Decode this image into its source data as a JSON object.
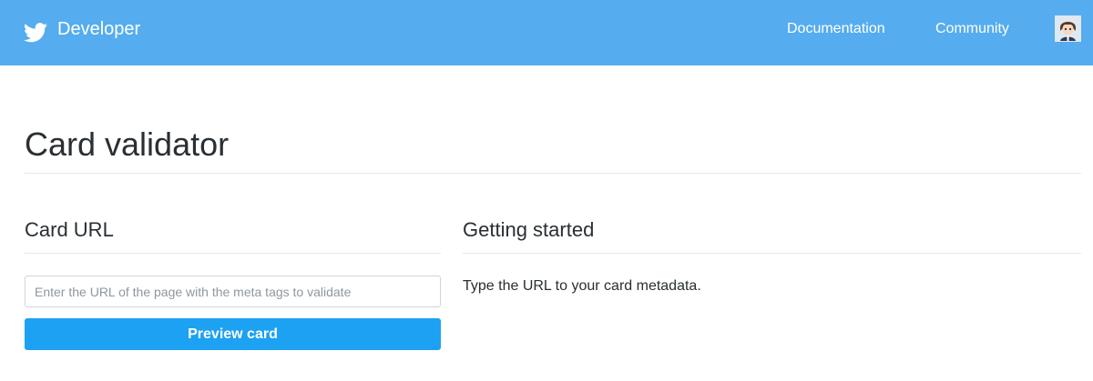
{
  "header": {
    "brand_icon": "twitter-bird-icon",
    "brand_label": "Developer",
    "nav": {
      "documentation": "Documentation",
      "community": "Community"
    },
    "avatar_icon": "user-avatar-icon",
    "colors": {
      "bar": "#55acee",
      "text": "#ffffff"
    }
  },
  "page": {
    "title": "Card validator"
  },
  "card_url": {
    "heading": "Card URL",
    "input_value": "",
    "input_placeholder": "Enter the URL of the page with the meta tags to validate",
    "button_label": "Preview card",
    "button_color": "#1da1f2"
  },
  "getting_started": {
    "heading": "Getting started",
    "text": "Type the URL to your card metadata."
  }
}
